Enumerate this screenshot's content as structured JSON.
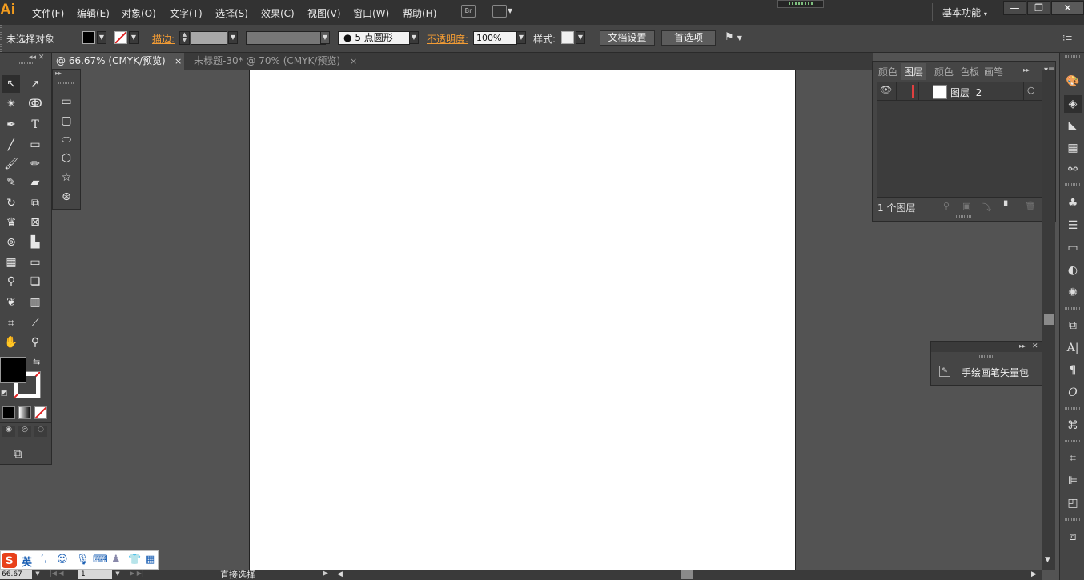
{
  "app": {
    "logo": "Ai",
    "brand_color": "#f29c1f"
  },
  "menu": [
    "文件(F)",
    "编辑(E)",
    "对象(O)",
    "文字(T)",
    "选择(S)",
    "效果(C)",
    "视图(V)",
    "窗口(W)",
    "帮助(H)"
  ],
  "bridge_label": "Br",
  "workspace": {
    "label": "基本功能"
  },
  "window_controls": {
    "minimize": "—",
    "restore": "❐",
    "close": "✕"
  },
  "control": {
    "selection_label": "未选择对象",
    "stroke_label": "描边:",
    "brush_value": "5 点圆形",
    "opacity_label": "不透明度:",
    "opacity_value": "100%",
    "style_label": "样式:",
    "doc_setup": "文档设置",
    "preferences": "首选项"
  },
  "tabs": [
    {
      "label": "@ 66.67% (CMYK/预览)",
      "close": "×",
      "active": true
    },
    {
      "label": "未标题-30* @ 70% (CMYK/预览)",
      "close": "×",
      "active": false
    }
  ],
  "layers_panel": {
    "tabs": [
      "颜色",
      "图层",
      "颜色",
      "色板",
      "画笔"
    ],
    "active_tab": "图层",
    "layer": {
      "name": "图层",
      "number": "2"
    },
    "count_label": "1 个图层"
  },
  "brush_panel": {
    "item": "手绘画笔矢量包"
  },
  "status": {
    "zoom": "66.67",
    "page": "1",
    "tool": "直接选择"
  },
  "ime": {
    "brand": "S",
    "lang": "英"
  },
  "colors": {
    "accent_orange": "#f39c34",
    "layer_color": "#e04040",
    "artboard": "#ffffff"
  }
}
